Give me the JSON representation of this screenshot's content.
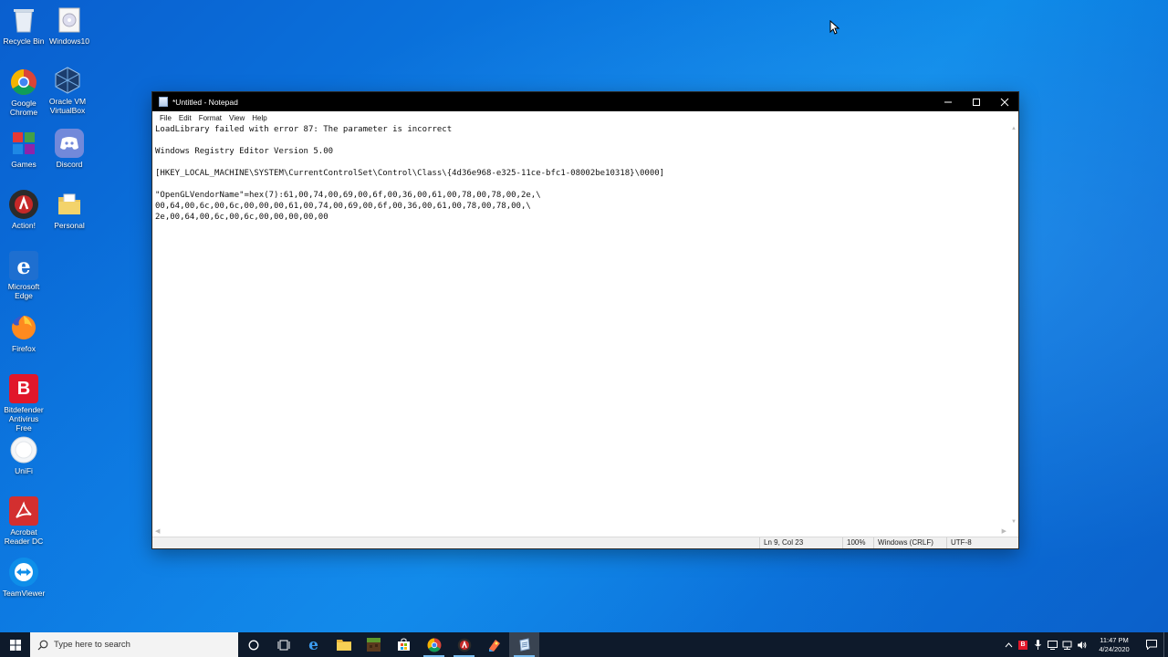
{
  "desktop": {
    "icons": [
      {
        "label": "Recycle Bin",
        "icon": "recycle-bin-icon"
      },
      {
        "label": "Windows10",
        "icon": "disc-icon"
      },
      {
        "label": "Google\nChrome",
        "icon": "chrome-icon"
      },
      {
        "label": "Oracle VM\nVirtualBox",
        "icon": "virtualbox-icon"
      },
      {
        "label": "Games",
        "icon": "games-folder-icon"
      },
      {
        "label": "Discord",
        "icon": "discord-icon"
      },
      {
        "label": "Action!",
        "icon": "action-recorder-icon"
      },
      {
        "label": "Personal",
        "icon": "folder-icon"
      },
      {
        "label": "Microsoft\nEdge",
        "icon": "edge-icon"
      },
      {
        "label": "Firefox",
        "icon": "firefox-icon"
      },
      {
        "label": "Bitdefender\nAntivirus Free",
        "icon": "bitdefender-icon"
      },
      {
        "label": "UniFi",
        "icon": "unifi-icon"
      },
      {
        "label": "Acrobat\nReader DC",
        "icon": "acrobat-icon"
      },
      {
        "label": "TeamViewer",
        "icon": "teamviewer-icon"
      }
    ]
  },
  "notepad": {
    "title": "*Untitled - Notepad",
    "menu": [
      "File",
      "Edit",
      "Format",
      "View",
      "Help"
    ],
    "lines": [
      "LoadLibrary failed with error 87: The parameter is incorrect",
      "",
      "Windows Registry Editor Version 5.00",
      "",
      "[HKEY_LOCAL_MACHINE\\SYSTEM\\CurrentControlSet\\Control\\Class\\{4d36e968-e325-11ce-bfc1-08002be10318}\\0000]",
      "",
      "\"OpenGLVendorName\"=hex(7):61,00,74,00,69,00,6f,00,36,00,61,00,78,00,78,00,2e,\\",
      "00,64,00,6c,00,6c,00,00,00,61,00,74,00,69,00,6f,00,36,00,61,00,78,00,78,00,\\",
      "2e,00,64,00,6c,00,6c,00,00,00,00,00"
    ],
    "status": {
      "position": "Ln 9, Col 23",
      "zoom": "100%",
      "line_ending": "Windows (CRLF)",
      "encoding": "UTF-8"
    }
  },
  "taskbar": {
    "search_placeholder": "Type here to search",
    "pinned": [
      "cortana-icon",
      "task-view-icon",
      "edge-icon",
      "file-explorer-icon",
      "minecraft-icon",
      "store-icon",
      "chrome-icon",
      "action-recorder-icon",
      "paint-icon",
      "notepad-icon"
    ],
    "clock_time": "11:47 PM",
    "clock_date": "4/24/2020"
  },
  "colors": {
    "desktop_blue": "#0a78e0",
    "taskbar": "#0e1a2b",
    "titlebar": "#000000"
  }
}
